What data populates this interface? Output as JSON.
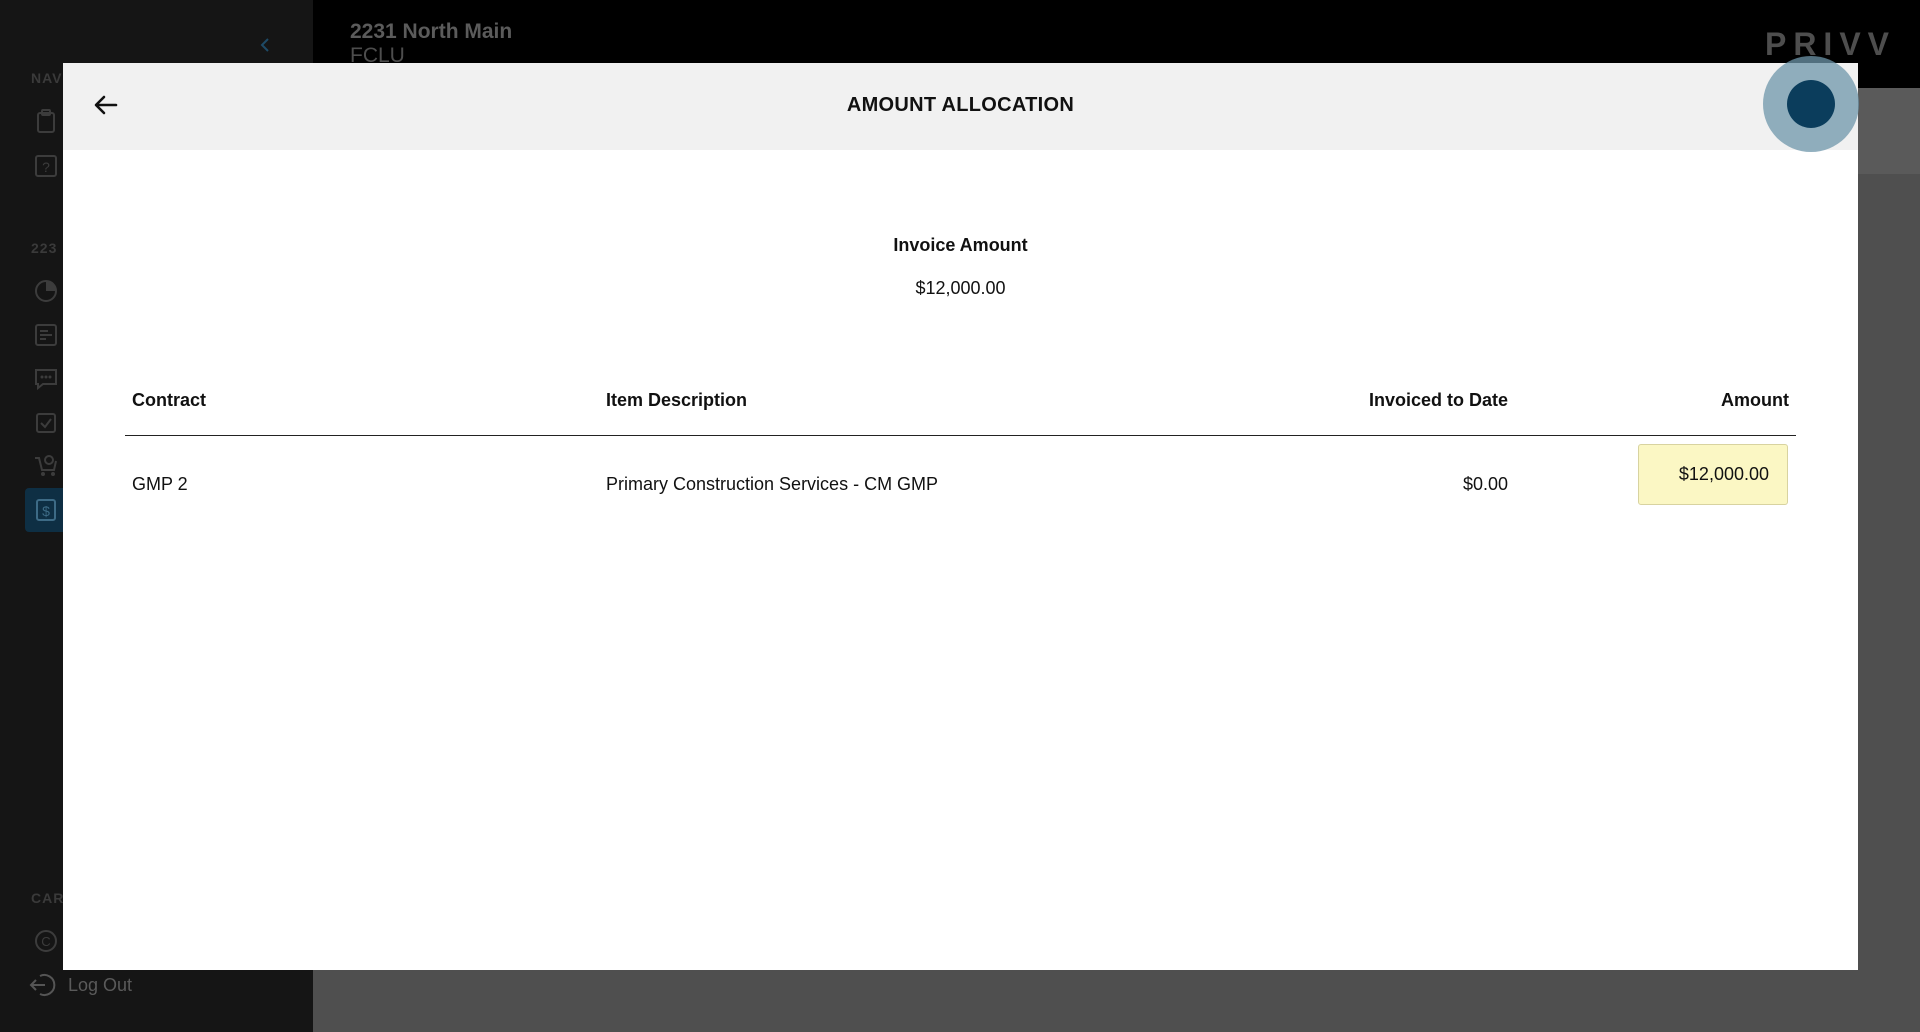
{
  "background": {
    "sidebar": {
      "section_nav": "NAV",
      "section_project": "223",
      "section_care": "CAR",
      "logout_label": "Log Out"
    },
    "project": {
      "title": "2231 North Main",
      "subtitle": "FCLU"
    },
    "brand": "PRIVV"
  },
  "modal": {
    "title": "AMOUNT ALLOCATION",
    "invoice_amount_label": "Invoice Amount",
    "invoice_amount_value": "$12,000.00",
    "table": {
      "headers": {
        "contract": "Contract",
        "description": "Item Description",
        "invoiced": "Invoiced to Date",
        "amount": "Amount"
      },
      "rows": [
        {
          "contract": "GMP 2",
          "description": "Primary Construction Services - CM GMP",
          "invoiced": "$0.00",
          "amount": "$12,000.00"
        }
      ]
    }
  },
  "colors": {
    "accent": "#0b3d5c",
    "input_highlight": "#fbf7c4",
    "overlay": "#4f4f4f"
  }
}
